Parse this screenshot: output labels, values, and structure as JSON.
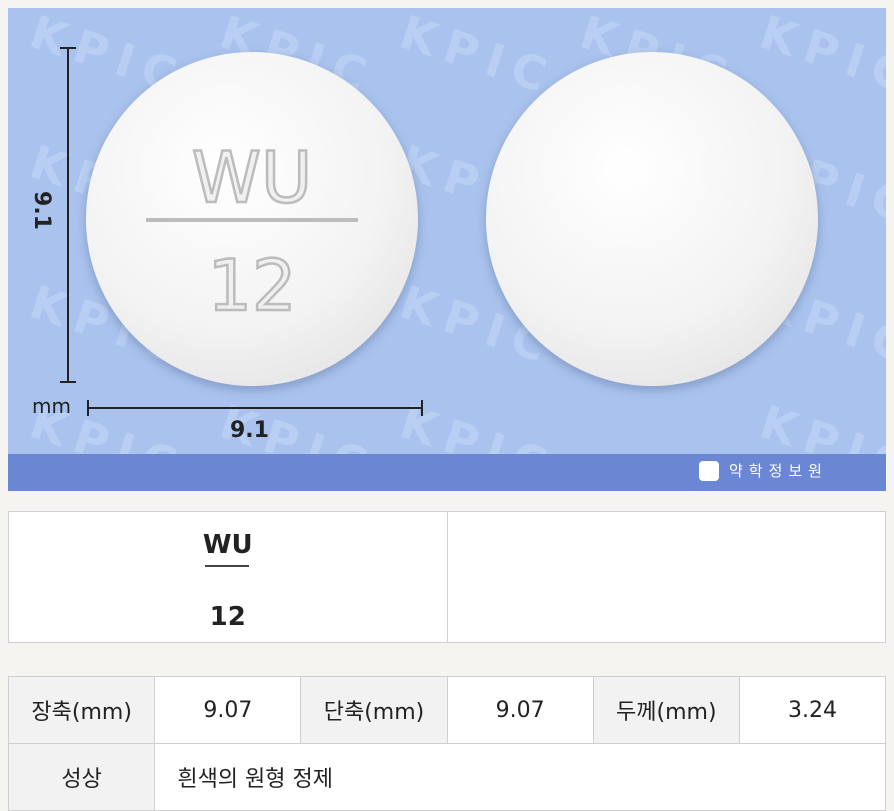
{
  "image": {
    "watermark_text": "KPIC",
    "size_vertical": "9.1",
    "size_horizontal": "9.1",
    "unit": "mm",
    "provider_label": "약학정보원",
    "front_imprint_top": "WU",
    "front_imprint_bottom": "12"
  },
  "marking": {
    "front_top": "WU",
    "front_bottom": "12",
    "back": ""
  },
  "specs": {
    "long_axis_label": "장축(mm)",
    "long_axis_value": "9.07",
    "short_axis_label": "단축(mm)",
    "short_axis_value": "9.07",
    "thickness_label": "두께(mm)",
    "thickness_value": "3.24",
    "appearance_label": "성상",
    "appearance_value": "흰색의 원형 정제"
  }
}
